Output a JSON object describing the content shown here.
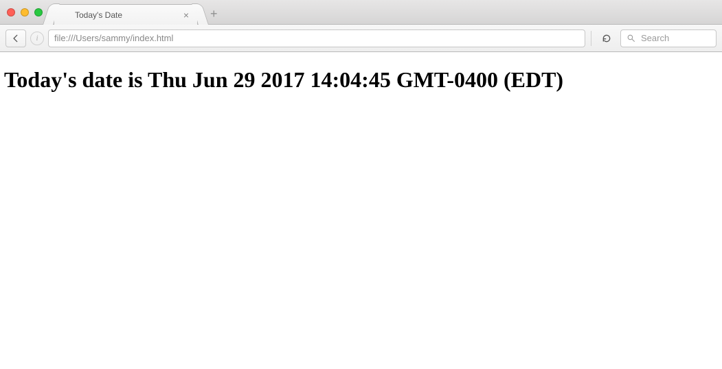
{
  "window": {
    "tab_title": "Today's Date"
  },
  "toolbar": {
    "url": "file:///Users/sammy/index.html",
    "search_placeholder": "Search"
  },
  "page": {
    "heading": "Today's date is Thu Jun 29 2017 14:04:45 GMT-0400 (EDT)"
  }
}
